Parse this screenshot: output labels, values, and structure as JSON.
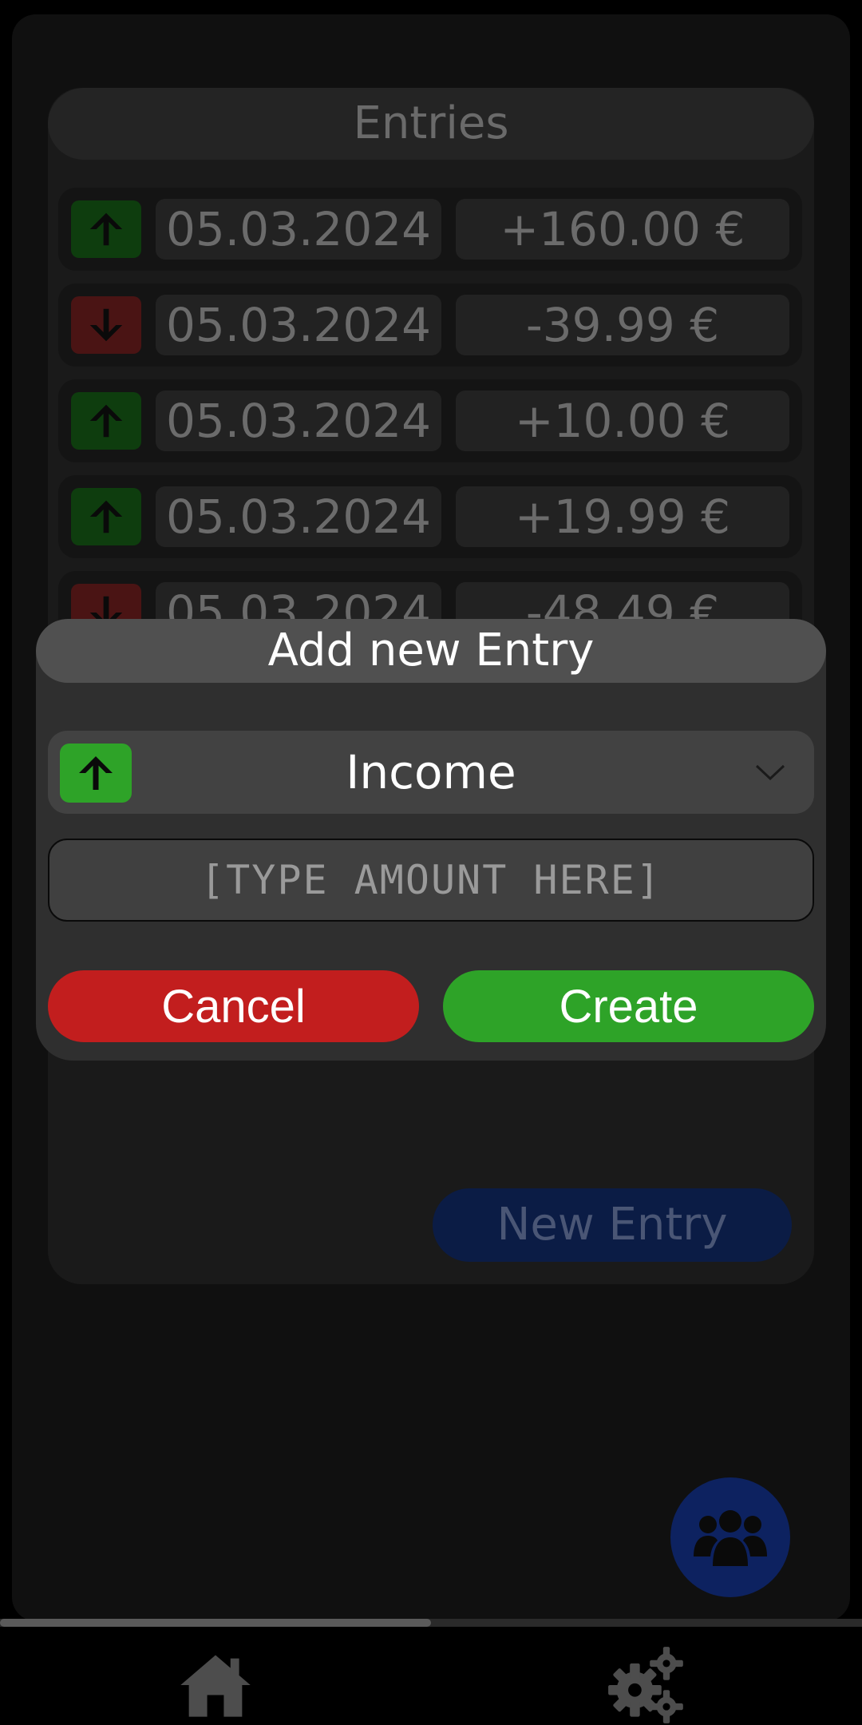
{
  "entries": {
    "title": "Entries",
    "rows": [
      {
        "direction": "up",
        "date": "05.03.2024",
        "amount": "+160.00 €"
      },
      {
        "direction": "down",
        "date": "05.03.2024",
        "amount": "-39.99 €"
      },
      {
        "direction": "up",
        "date": "05.03.2024",
        "amount": "+10.00 €"
      },
      {
        "direction": "up",
        "date": "05.03.2024",
        "amount": "+19.99 €"
      },
      {
        "direction": "down",
        "date": "05.03.2024",
        "amount": "-48.49 €"
      }
    ],
    "new_entry_label": "New Entry"
  },
  "dialog": {
    "title": "Add new Entry",
    "type_selected": "Income",
    "type_icon": "arrow-up-icon",
    "amount_placeholder": "[TYPE AMOUNT HERE]",
    "amount_value": "",
    "cancel_label": "Cancel",
    "create_label": "Create"
  },
  "nav": {
    "items": [
      {
        "icon": "home-icon",
        "active": true
      },
      {
        "icon": "settings-gears-icon",
        "active": false
      }
    ]
  },
  "fab": {
    "icon": "group-users-icon"
  },
  "colors": {
    "income": "#2ea328",
    "expense": "#c21e1e",
    "accent_blue": "#0d2260",
    "dialog_bg": "#2f2f2f"
  }
}
